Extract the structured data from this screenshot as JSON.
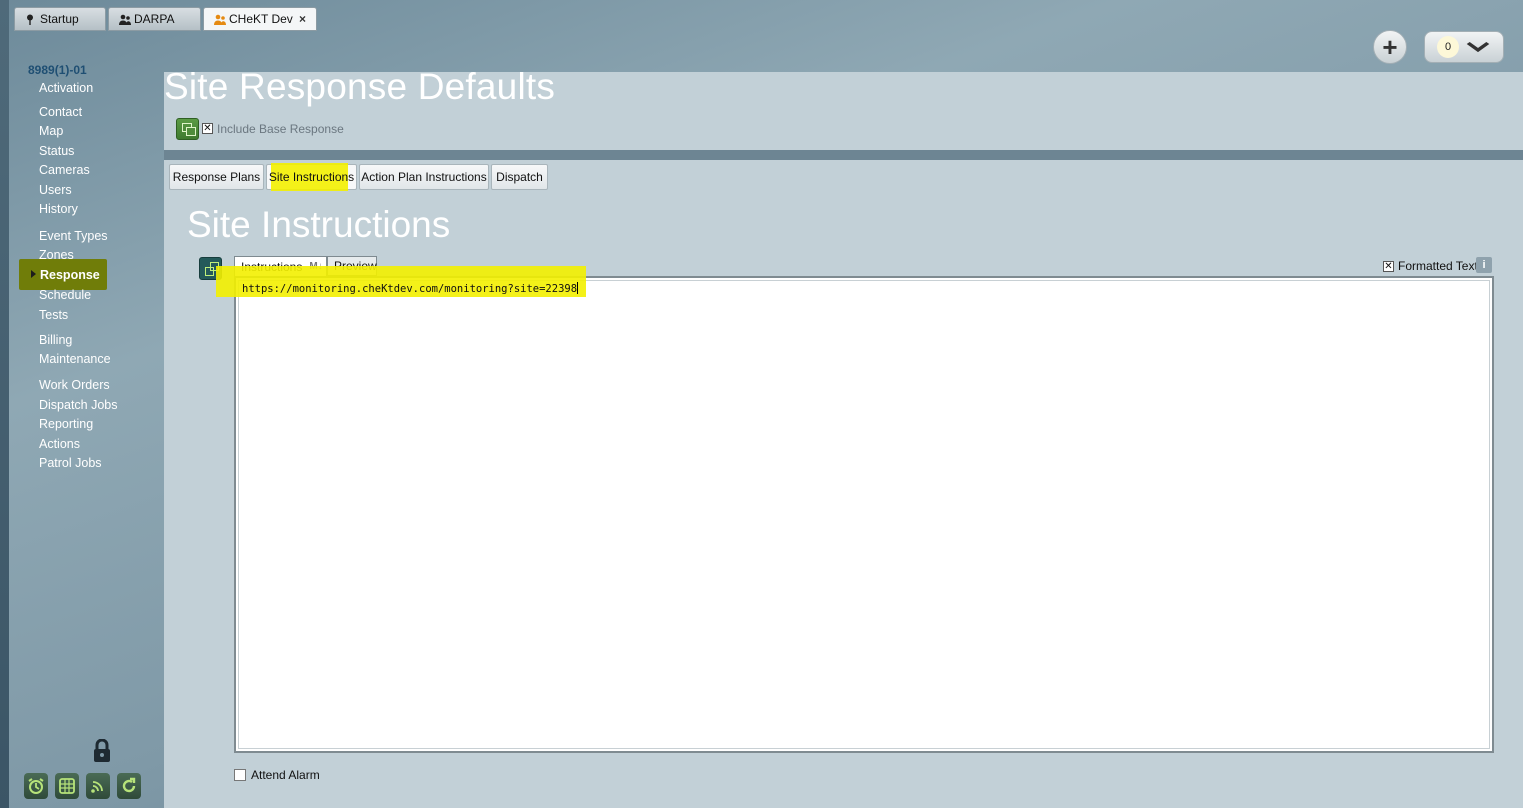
{
  "window_tabs": [
    {
      "label": "Startup",
      "icon": "pin-icon"
    },
    {
      "label": "DARPA",
      "icon": "people-icon"
    },
    {
      "label": "CHeKT Dev",
      "icon": "people-orange-icon",
      "active": true
    }
  ],
  "tab_close": "×",
  "header_actions": {
    "add_symbol": "+",
    "counter_value": "0"
  },
  "sidebar": {
    "site_id": "8989(1)-01",
    "items": [
      {
        "label": "Activation"
      },
      {
        "label": "Contact"
      },
      {
        "label": "Map"
      },
      {
        "label": "Status"
      },
      {
        "label": "Cameras"
      },
      {
        "label": "Users"
      },
      {
        "label": "History"
      },
      {
        "label": "Event Types"
      },
      {
        "label": "Zones"
      },
      {
        "label": "Response",
        "selected": true
      },
      {
        "label": "Schedule"
      },
      {
        "label": "Tests"
      },
      {
        "label": "Billing"
      },
      {
        "label": "Maintenance"
      },
      {
        "label": "Work Orders"
      },
      {
        "label": "Dispatch Jobs"
      },
      {
        "label": "Reporting"
      },
      {
        "label": "Actions"
      },
      {
        "label": "Patrol Jobs"
      }
    ],
    "bottom_icons": [
      "alarm-clock-icon",
      "grid-globe-icon",
      "signal-waves-icon",
      "refresh-icon"
    ]
  },
  "page": {
    "title": "Site Response Defaults",
    "include_base_checked": "✕",
    "include_base_label": "Include Base Response"
  },
  "sub_tabs": [
    {
      "label": "Response Plans"
    },
    {
      "label": "Site Instructions",
      "active": true
    },
    {
      "label": "Action Plan Instructions"
    },
    {
      "label": "Dispatch"
    }
  ],
  "section": {
    "title": "Site Instructions",
    "editor_tabs": {
      "instructions": "Instructions",
      "markdown_badge": "M↓",
      "preview": "Preview"
    },
    "formatted_checked": "✕",
    "formatted_label": "Formatted Text",
    "info_symbol": "i",
    "editor_value": "https://monitoring.cheKtdev.com/monitoring?site=22398",
    "attend_alarm_label": "Attend Alarm"
  },
  "colors": {
    "highlight": "#f3f000",
    "selected_nav": "#7b8a00",
    "panel": "#c2d0d7",
    "site_id": "#1f4f73"
  }
}
